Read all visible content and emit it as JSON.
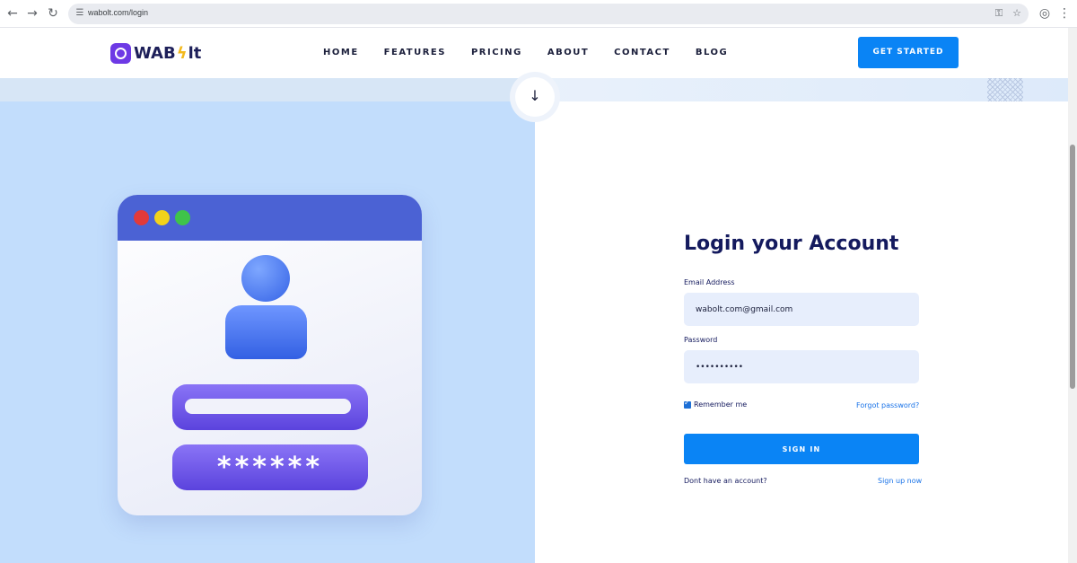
{
  "browser": {
    "url": "wabolt.com/login",
    "icons": [
      "back-icon",
      "forward-icon",
      "reload-icon",
      "site-settings-icon",
      "password-key-icon",
      "bookmark-star-icon",
      "profile-icon",
      "menu-kebab-icon"
    ]
  },
  "header": {
    "logo_text_left": "WAB",
    "logo_text_right": "lt",
    "nav": [
      "HOME",
      "FEATURES",
      "PRICING",
      "ABOUT",
      "CONTACT",
      "BLOG"
    ],
    "cta_label": "GET STARTED"
  },
  "illustration": {
    "password_mask": "******"
  },
  "login": {
    "title": "Login your Account",
    "email_label": "Email Address",
    "email_value": "wabolt.com@gmail.com",
    "password_label": "Password",
    "password_value": "••••••••••",
    "remember_label": "Remember me",
    "remember_checked": true,
    "forgot_label": "Forgot password?",
    "signin_label": "SIGN IN",
    "no_account_label": "Dont have an account?",
    "signup_label": "Sign up now"
  },
  "colors": {
    "primary": "#0a84f5",
    "heading": "#141a5e",
    "left_panel": "#c2ddfc",
    "field_bg": "#e7eefc"
  }
}
